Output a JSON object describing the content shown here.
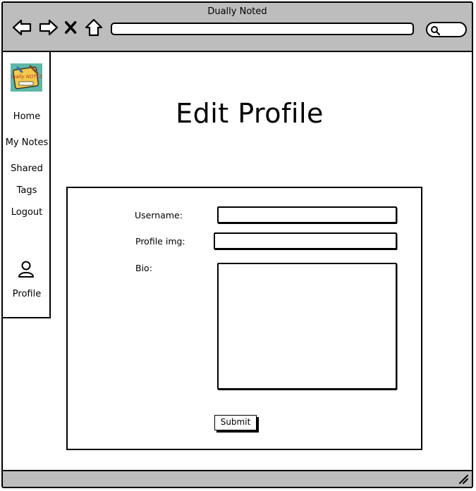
{
  "window": {
    "title": "Dually Noted"
  },
  "toolbar": {
    "icons": [
      "back-arrow-icon",
      "forward-arrow-icon",
      "close-x-icon",
      "home-icon",
      "search-icon"
    ]
  },
  "sidebar": {
    "logo_text": "Dually NOTED",
    "items": [
      {
        "label": "Home"
      },
      {
        "label": "My Notes"
      },
      {
        "label": "Shared"
      },
      {
        "label": "Tags"
      },
      {
        "label": "Logout"
      }
    ],
    "profile_label": "Profile"
  },
  "main": {
    "title": "Edit Profile",
    "form": {
      "username_label": "Username:",
      "username_value": "",
      "profile_img_label": "Profile img:",
      "profile_img_value": "",
      "bio_label": "Bio:",
      "bio_value": "",
      "submit_label": "Submit"
    }
  },
  "colors": {
    "chrome": "#bdbdbd",
    "logo_bg": "#5fb8a7",
    "logo_badge": "#f2c94c"
  }
}
